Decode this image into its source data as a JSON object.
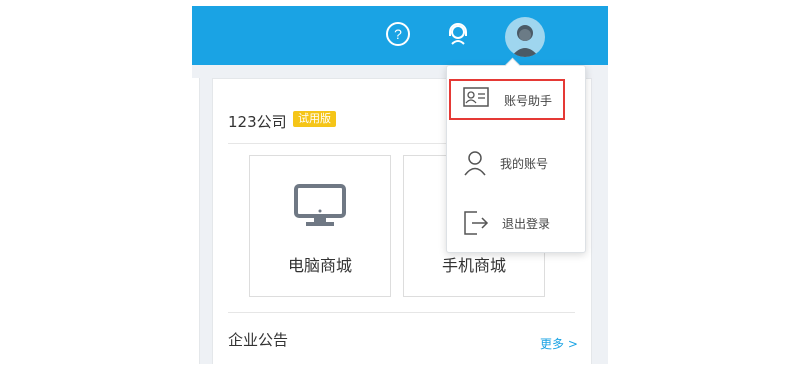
{
  "header": {
    "help_icon": "question-circle-icon",
    "support_icon": "headset-icon",
    "avatar_icon": "user-avatar"
  },
  "company": {
    "name": "123公司",
    "badge": "试用版"
  },
  "tiles": [
    {
      "label": "电脑商城",
      "icon": "monitor-icon"
    },
    {
      "label": "手机商城",
      "icon": "phone-icon"
    }
  ],
  "notice": {
    "title": "企业公告",
    "more": "更多 >"
  },
  "dropdown": {
    "items": [
      {
        "label": "账号助手",
        "icon": "id-card-icon"
      },
      {
        "label": "我的账号",
        "icon": "user-icon"
      },
      {
        "label": "退出登录",
        "icon": "logout-icon"
      }
    ]
  },
  "colors": {
    "header": "#1aa3e4",
    "badge": "#f5c518",
    "highlight": "#e53935",
    "link": "#1aa3e4"
  }
}
